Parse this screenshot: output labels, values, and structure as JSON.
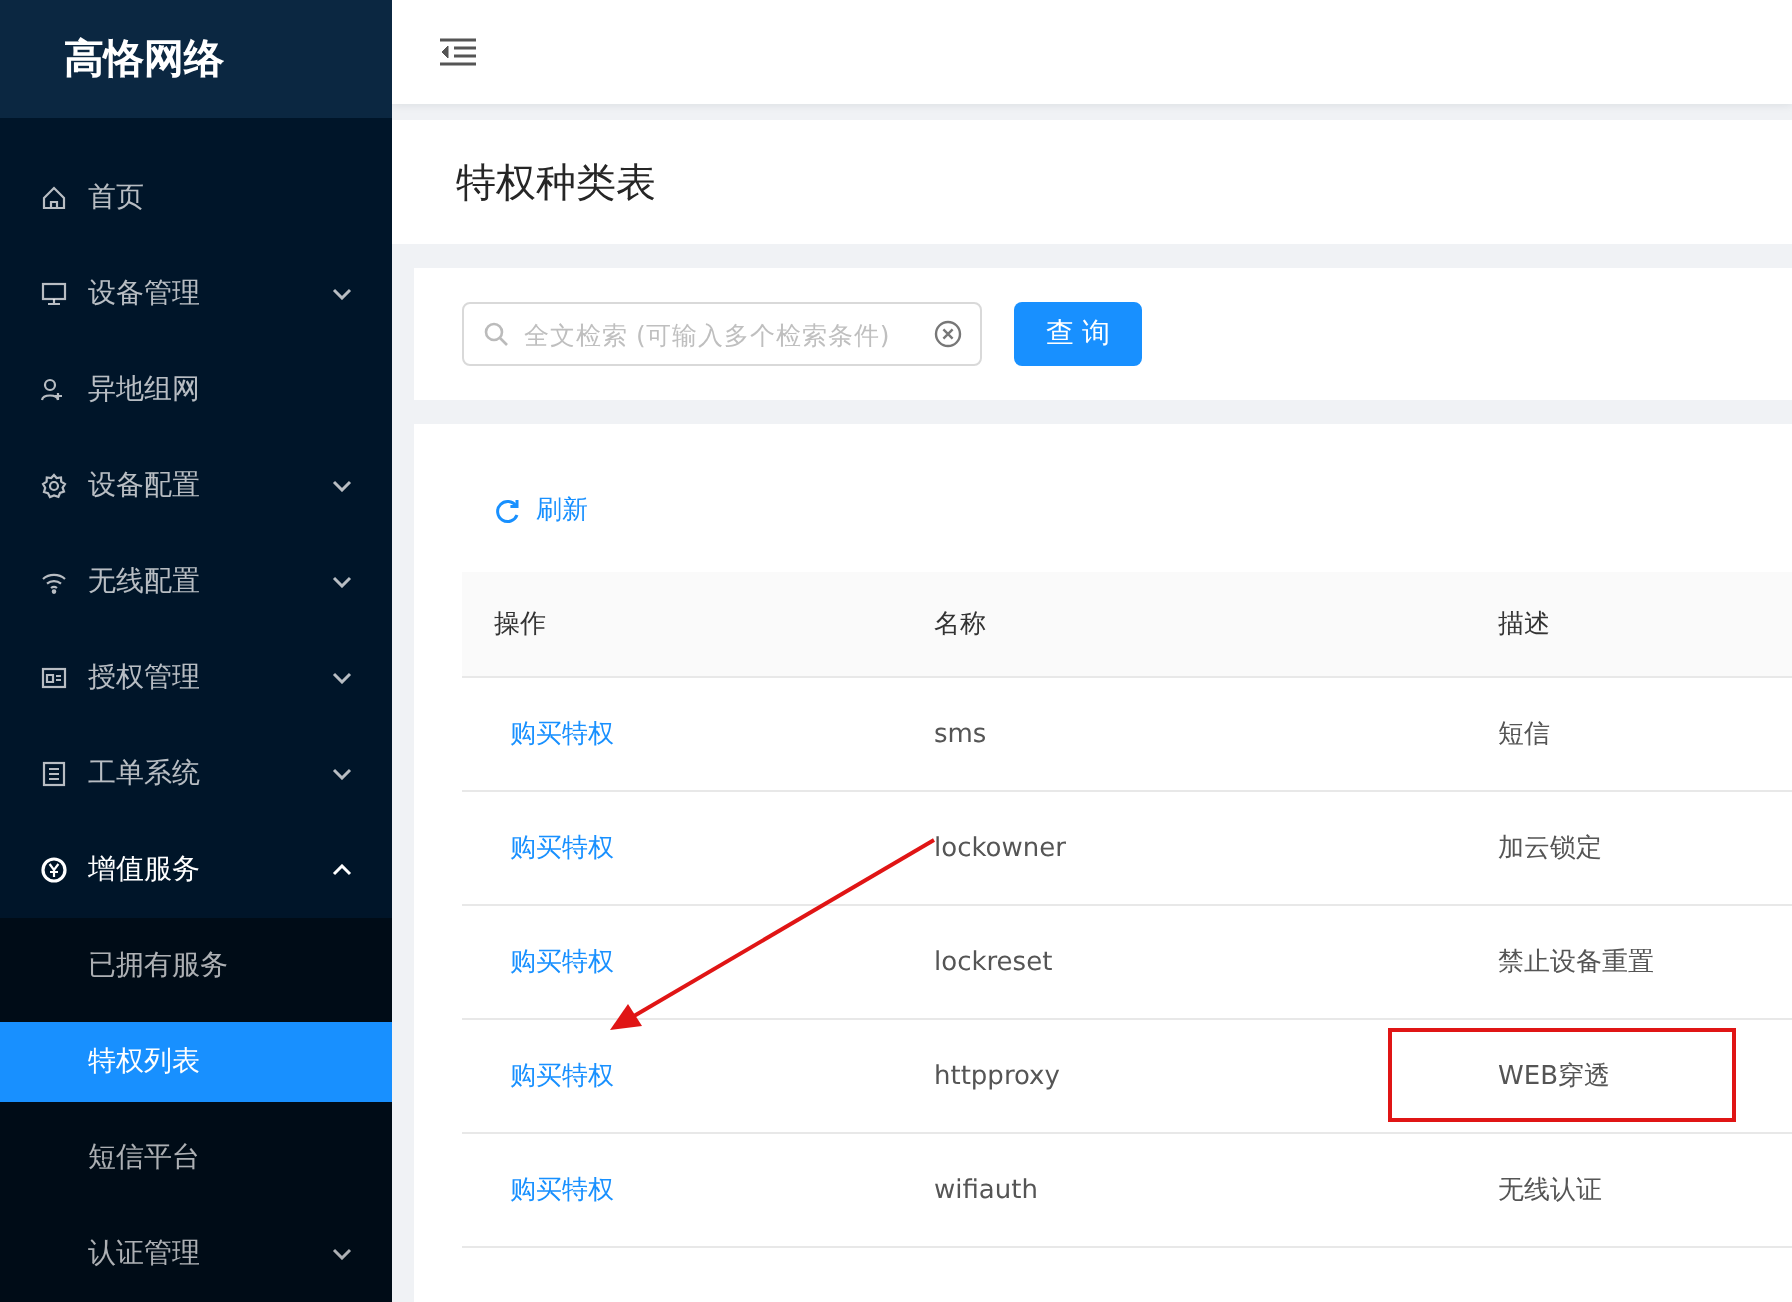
{
  "brand": "高恪网络",
  "menu": [
    {
      "label": "首页",
      "expandable": false,
      "expanded": false
    },
    {
      "label": "设备管理",
      "expandable": true,
      "expanded": false
    },
    {
      "label": "异地组网",
      "expandable": false,
      "expanded": false
    },
    {
      "label": "设备配置",
      "expandable": true,
      "expanded": false
    },
    {
      "label": "无线配置",
      "expandable": true,
      "expanded": false
    },
    {
      "label": "授权管理",
      "expandable": true,
      "expanded": false
    },
    {
      "label": "工单系统",
      "expandable": true,
      "expanded": false
    },
    {
      "label": "增值服务",
      "expandable": true,
      "expanded": true,
      "children": [
        {
          "label": "已拥有服务",
          "selected": false,
          "expandable": false
        },
        {
          "label": "特权列表",
          "selected": true,
          "expandable": false
        },
        {
          "label": "短信平台",
          "selected": false,
          "expandable": false
        },
        {
          "label": "认证管理",
          "selected": false,
          "expandable": true
        }
      ]
    }
  ],
  "page_title": "特权种类表",
  "search": {
    "placeholder": "全文检索 (可输入多个检索条件)",
    "button": "查 询"
  },
  "refresh": "刷新",
  "table": {
    "columns": [
      "操作",
      "名称",
      "描述"
    ],
    "rows": [
      {
        "action": "购买特权",
        "name": "sms",
        "description": "短信",
        "highlighted": false
      },
      {
        "action": "购买特权",
        "name": "lockowner",
        "description": "加云锁定",
        "highlighted": false
      },
      {
        "action": "购买特权",
        "name": "lockreset",
        "description": "禁止设备重置",
        "highlighted": false
      },
      {
        "action": "购买特权",
        "name": "httpproxy",
        "description": "WEB穿透",
        "highlighted": true
      },
      {
        "action": "购买特权",
        "name": "wifiauth",
        "description": "无线认证",
        "highlighted": false
      }
    ]
  }
}
